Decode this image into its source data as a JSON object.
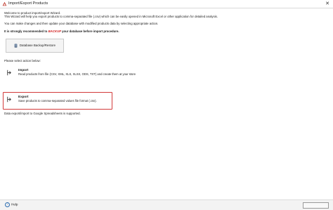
{
  "window": {
    "title": "Import/Export Products",
    "close_glyph": "✕"
  },
  "intro": {
    "line1": "Welcome to product import/export Wizard.",
    "line2": "This Wizard will help you export products to comma-separated file (.csv) which can be easily opened in Microsoft Excel or other application for detailed analysis.",
    "line3": "You can make changes and then update your database with modified products data by selecting appropriate action."
  },
  "warning": {
    "before": "It is strongly recommended to ",
    "highlight": "BACKUP",
    "after": " your database before import procedure.",
    "highlight_color": "#d21f1f"
  },
  "backup_button": {
    "label": "Database Backup/Restore",
    "icon": "database-icon"
  },
  "select_action_label": "Please select action below:",
  "actions": [
    {
      "title": "Import",
      "description": "Read products from file (CSV, XML, XLS, XLSX, ODS, TXT) and create them at your store",
      "icon": "import-arrow-icon"
    },
    {
      "title": "Export",
      "description": "Save products to comma-separated values file format (.csv).",
      "icon": "export-arrow-icon"
    }
  ],
  "note": "Data export/import to Google Spreadsheets is supported.",
  "footer": {
    "help_label": "Help",
    "help_icon": "help-icon",
    "back_button_label": ""
  },
  "colors": {
    "accent_red": "#d23a3a",
    "link_blue": "#2b6cb0"
  }
}
